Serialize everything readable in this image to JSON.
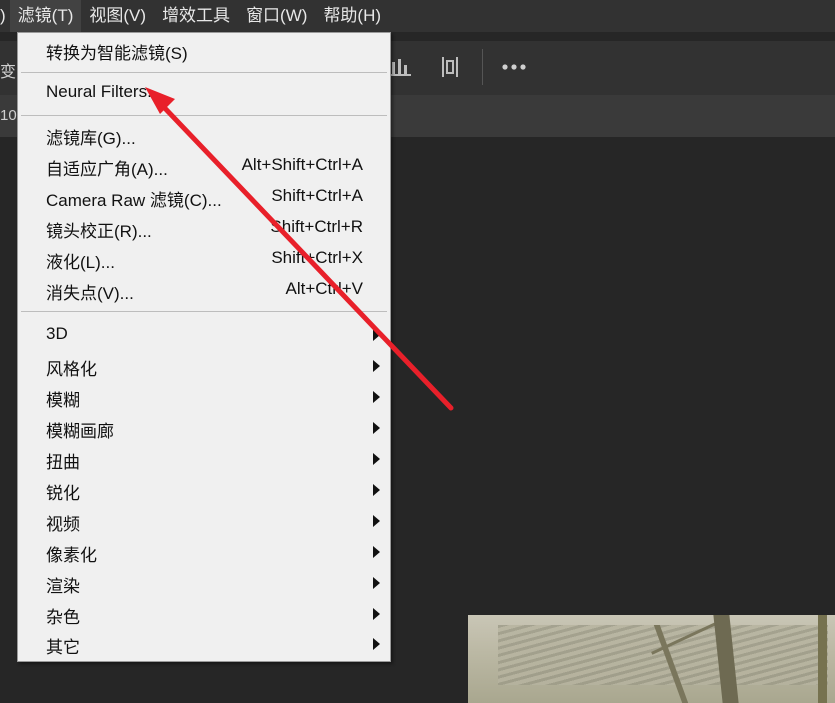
{
  "menubar": {
    "items": [
      ")",
      "滤镜(T)",
      "视图(V)",
      "增效工具",
      "窗口(W)",
      "帮助(H)"
    ]
  },
  "optionsbar": {
    "cut_text": "变"
  },
  "tabbar": {
    "cut_text": "10"
  },
  "filter_menu": {
    "convert_smart": "转换为智能滤镜(S)",
    "neural_filters": "Neural Filters...",
    "gallery": "滤镜库(G)...",
    "adaptive_wide": {
      "label": "自适应广角(A)...",
      "shortcut": "Alt+Shift+Ctrl+A"
    },
    "camera_raw": {
      "label": "Camera Raw 滤镜(C)...",
      "shortcut": "Shift+Ctrl+A"
    },
    "lens_correction": {
      "label": "镜头校正(R)...",
      "shortcut": "Shift+Ctrl+R"
    },
    "liquify": {
      "label": "液化(L)...",
      "shortcut": "Shift+Ctrl+X"
    },
    "vanishing_point": {
      "label": "消失点(V)...",
      "shortcut": "Alt+Ctrl+V"
    },
    "submenus": [
      "3D",
      "风格化",
      "模糊",
      "模糊画廊",
      "扭曲",
      "锐化",
      "视频",
      "像素化",
      "渲染",
      "杂色",
      "其它"
    ]
  },
  "colors": {
    "annotation_arrow": "#e8202a",
    "menu_bg": "#f0f0f0",
    "app_bg": "#262626"
  },
  "icons": [
    "distribute-bars-icon",
    "align-icon",
    "more-options-icon",
    "submenu-arrow-icon"
  ]
}
